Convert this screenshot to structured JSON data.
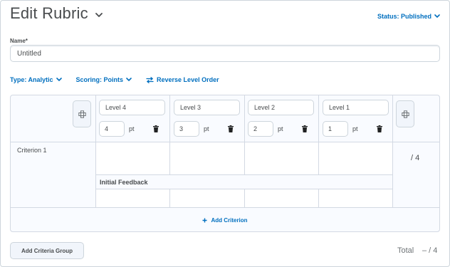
{
  "header": {
    "title": "Edit Rubric",
    "status_label": "Status: Published"
  },
  "name_field": {
    "label": "Name*",
    "value": "Untitled"
  },
  "options": {
    "type_label": "Type: Analytic",
    "scoring_label": "Scoring: Points",
    "reverse_label": "Reverse Level Order"
  },
  "levels": [
    {
      "name": "Level 4",
      "points": "4",
      "unit": "pt"
    },
    {
      "name": "Level 3",
      "points": "3",
      "unit": "pt"
    },
    {
      "name": "Level 2",
      "points": "2",
      "unit": "pt"
    },
    {
      "name": "Level 1",
      "points": "1",
      "unit": "pt"
    }
  ],
  "criteria": [
    {
      "name": "Criterion 1",
      "score": "/ 4"
    }
  ],
  "feedback_label": "Initial Feedback",
  "add_criterion_label": "Add Criterion",
  "add_group_label": "Add Criteria Group",
  "total": {
    "label": "Total",
    "value": "– / 4"
  },
  "colors": {
    "link": "#006fbf",
    "border": "#d3d9e3",
    "text": "#494c4e"
  }
}
